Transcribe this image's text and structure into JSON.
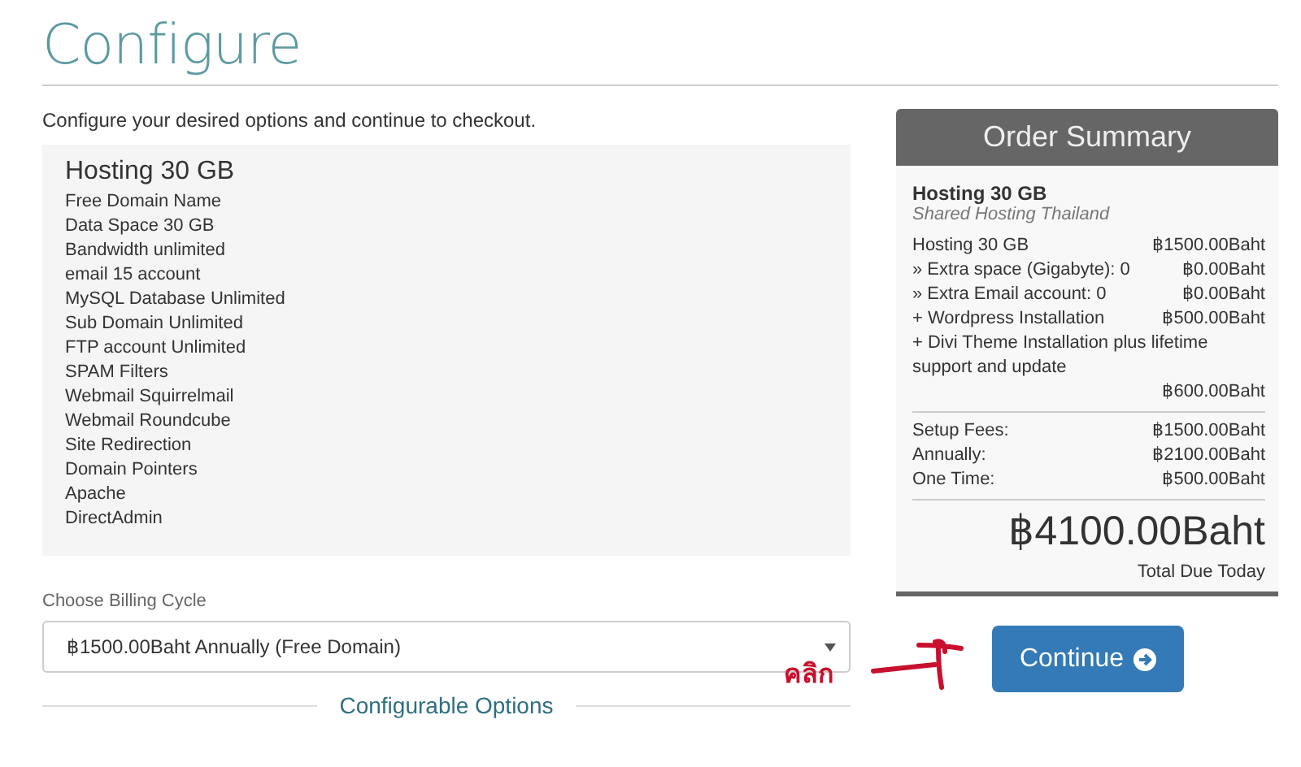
{
  "title": "Configure",
  "intro": "Configure your desired options and continue to checkout.",
  "product": {
    "name": "Hosting 30 GB",
    "features": [
      "Free Domain Name",
      "Data Space 30 GB",
      "Bandwidth unlimited",
      "email 15 account",
      "MySQL Database Unlimited",
      "Sub Domain Unlimited",
      "FTP account Unlimited",
      "SPAM Filters",
      "Webmail Squirrelmail",
      "Webmail Roundcube",
      "Site Redirection",
      "Domain Pointers",
      "Apache",
      "DirectAdmin"
    ]
  },
  "billing": {
    "label": "Choose Billing Cycle",
    "value": "฿1500.00Baht Annually (Free Domain)"
  },
  "section_heading": "Configurable Options",
  "annotation": "คลิก",
  "summary": {
    "title": "Order Summary",
    "product": "Hosting 30 GB",
    "group": "Shared Hosting Thailand",
    "items": [
      {
        "label": "Hosting 30 GB",
        "price": "฿1500.00Baht"
      },
      {
        "label": "» Extra space (Gigabyte): 0",
        "price": "฿0.00Baht"
      },
      {
        "label": "» Extra Email account: 0",
        "price": "฿0.00Baht"
      },
      {
        "label": "+ Wordpress Installation",
        "price": "฿500.00Baht"
      },
      {
        "label": "+ Divi Theme Installation plus lifetime support and update",
        "price": "฿600.00Baht"
      }
    ],
    "totals": [
      {
        "label": "Setup Fees:",
        "price": "฿1500.00Baht"
      },
      {
        "label": "Annually:",
        "price": "฿2100.00Baht"
      },
      {
        "label": "One Time:",
        "price": "฿500.00Baht"
      }
    ],
    "total": "฿4100.00Baht",
    "total_caption": "Total Due Today"
  },
  "continue_button": "Continue"
}
